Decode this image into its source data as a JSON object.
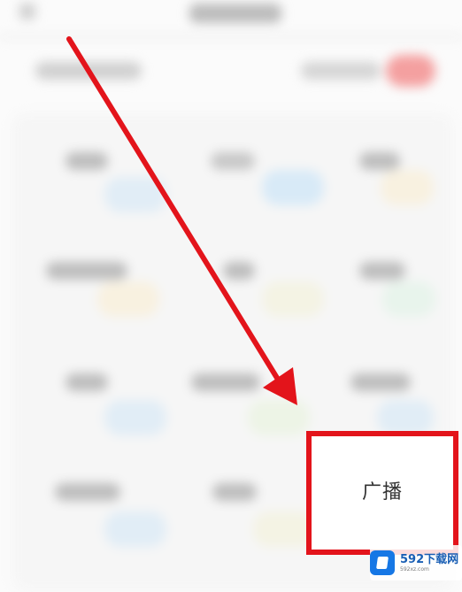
{
  "screen": {
    "blurred_content": "obscured settings grid"
  },
  "highlight": {
    "label": "广播"
  },
  "watermark": {
    "title": "592下载网",
    "url": "592xz.com"
  },
  "colors": {
    "arrow": "#e3141b",
    "highlight_border": "#e3141b",
    "watermark_logo": "#1677e5",
    "toggle_tint": "#f4a0a0"
  },
  "icons": {
    "arrow": "arrow-icon",
    "watermark_logo": "watermark-logo-icon"
  }
}
